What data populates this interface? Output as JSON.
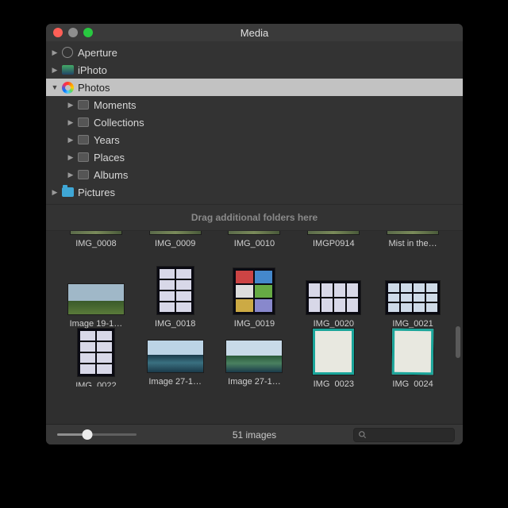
{
  "window": {
    "title": "Media"
  },
  "tree": {
    "items": [
      {
        "label": "Aperture",
        "icon": "aperture",
        "lvl": 0,
        "exp": false,
        "sel": false
      },
      {
        "label": "iPhoto",
        "icon": "iphoto",
        "lvl": 0,
        "exp": false,
        "sel": false
      },
      {
        "label": "Photos",
        "icon": "photos",
        "lvl": 0,
        "exp": true,
        "sel": true
      },
      {
        "label": "Moments",
        "icon": "box",
        "lvl": 1,
        "exp": false,
        "sel": false
      },
      {
        "label": "Collections",
        "icon": "box",
        "lvl": 1,
        "exp": false,
        "sel": false
      },
      {
        "label": "Years",
        "icon": "box",
        "lvl": 1,
        "exp": false,
        "sel": false
      },
      {
        "label": "Places",
        "icon": "box",
        "lvl": 1,
        "exp": false,
        "sel": false
      },
      {
        "label": "Albums",
        "icon": "box",
        "lvl": 1,
        "exp": false,
        "sel": false
      },
      {
        "label": "Pictures",
        "icon": "folder-blue",
        "lvl": 0,
        "exp": false,
        "sel": false
      }
    ]
  },
  "dropzone": "Drag additional folders here",
  "thumbs": [
    {
      "label": "IMG_0008",
      "variant": "sliver"
    },
    {
      "label": "IMG_0009",
      "variant": "sliver"
    },
    {
      "label": "IMG_0010",
      "variant": "sliver"
    },
    {
      "label": "IMGP0914",
      "variant": "sliver"
    },
    {
      "label": "Mist in the…",
      "variant": "sliver"
    },
    {
      "label": "Image 19-1…",
      "variant": "landscape"
    },
    {
      "label": "IMG_0018",
      "variant": "contact"
    },
    {
      "label": "IMG_0019",
      "variant": "multi"
    },
    {
      "label": "IMG_0020",
      "variant": "contact-w"
    },
    {
      "label": "IMG_0021",
      "variant": "contact-w2"
    },
    {
      "label": "IMG_0022",
      "variant": "contact"
    },
    {
      "label": "Image 27-1…",
      "variant": "mirror"
    },
    {
      "label": "Image 27-1…",
      "variant": "mirror2"
    },
    {
      "label": "IMG_0023",
      "variant": "doc"
    },
    {
      "label": "IMG_0024",
      "variant": "doc2"
    }
  ],
  "footer": {
    "count": "51 images",
    "slider_percent": 38,
    "search_placeholder": ""
  }
}
